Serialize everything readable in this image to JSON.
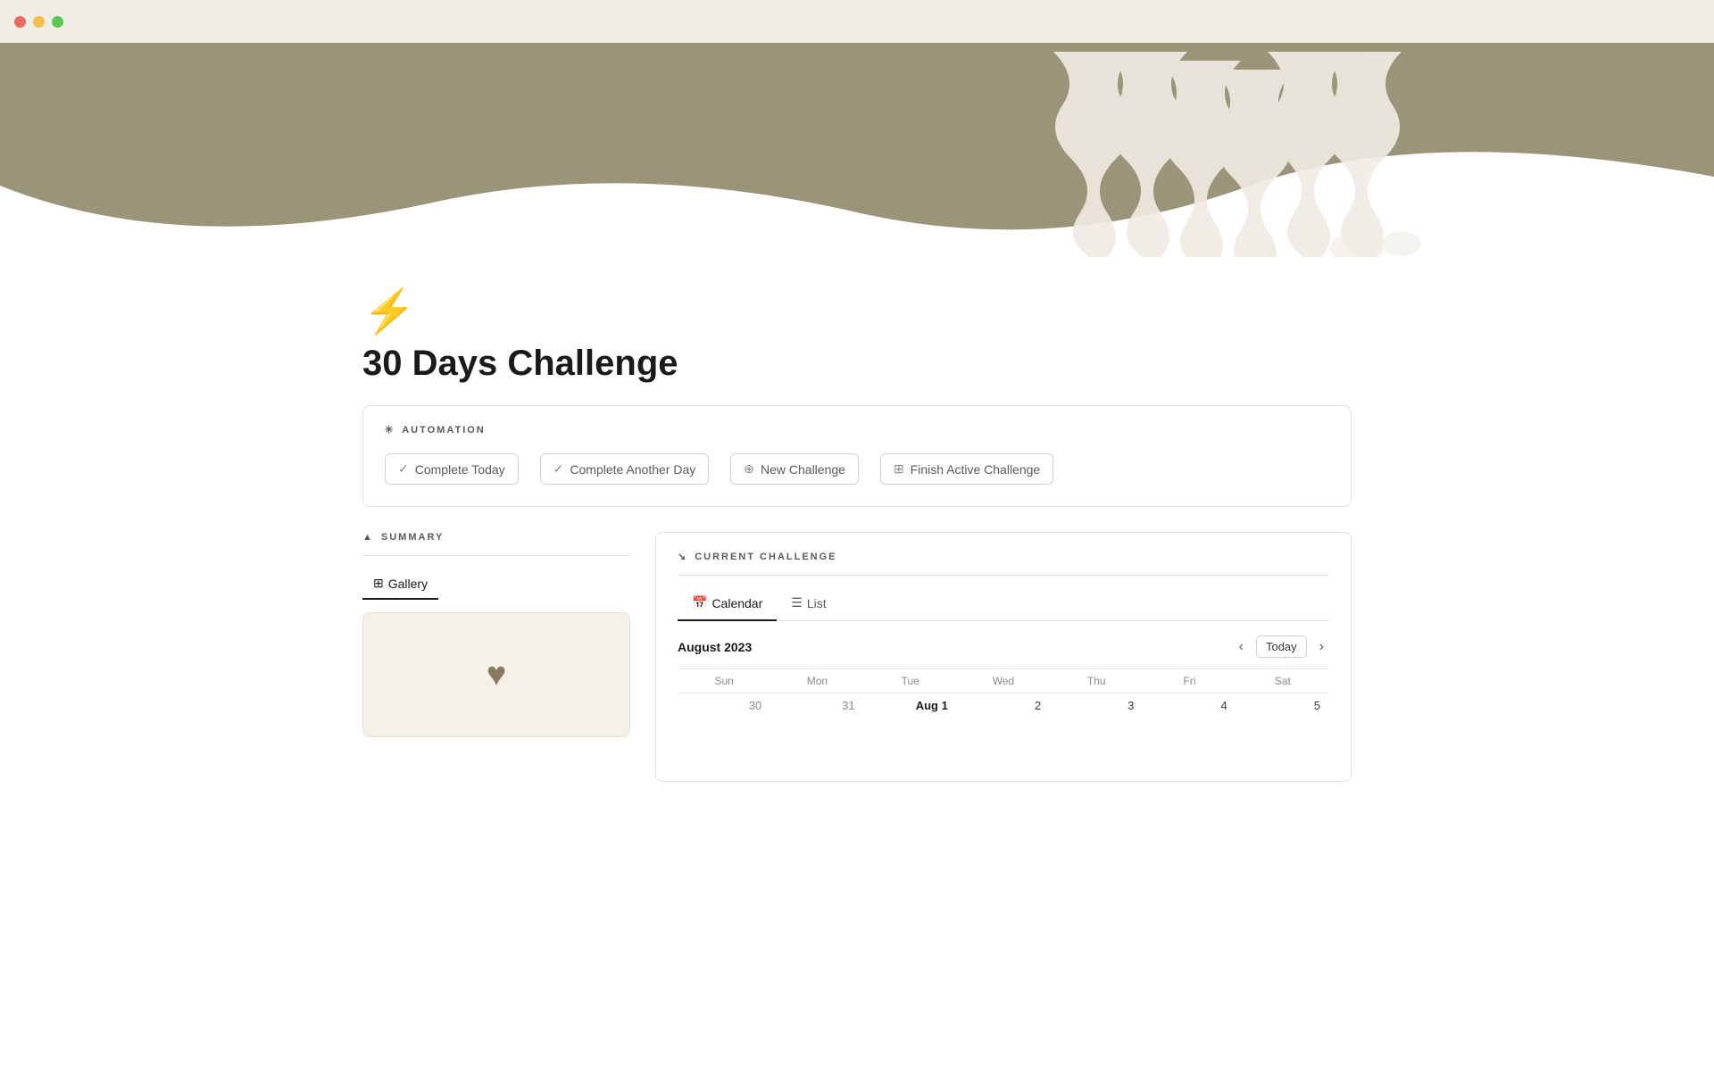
{
  "titlebar": {
    "traffic_red": "#ec6a5e",
    "traffic_yellow": "#f4bf4f",
    "traffic_green": "#61c554"
  },
  "hero": {
    "wave_color": "#9a9478",
    "decoration_color": "#f0ece6"
  },
  "page": {
    "icon": "⚡",
    "title": "30 Days Challenge"
  },
  "automation": {
    "header_icon": "✳",
    "header_label": "AUTOMATION",
    "buttons": [
      {
        "id": "complete-today",
        "icon": "✓",
        "label": "Complete Today"
      },
      {
        "id": "complete-another-day",
        "icon": "✓",
        "label": "Complete Another Day"
      },
      {
        "id": "new-challenge",
        "icon": "+",
        "label": "New Challenge"
      },
      {
        "id": "finish-active-challenge",
        "icon": "⊞",
        "label": "Finish Active Challenge"
      }
    ]
  },
  "summary": {
    "header_icon": "▲",
    "header_label": "SUMMARY",
    "tabs": [
      {
        "id": "gallery",
        "icon": "⊞",
        "label": "Gallery",
        "active": true
      }
    ],
    "gallery_card": {
      "icon": "♥"
    }
  },
  "current_challenge": {
    "header_icon": "↘",
    "header_label": "CURRENT CHALLENGE",
    "tabs": [
      {
        "id": "calendar",
        "icon": "📅",
        "label": "Calendar",
        "active": true
      },
      {
        "id": "list",
        "icon": "☰",
        "label": "List",
        "active": false
      }
    ],
    "calendar": {
      "month_label": "August 2023",
      "today_button": "Today",
      "weekdays": [
        "Sun",
        "Mon",
        "Tue",
        "Wed",
        "Thu",
        "Fri",
        "Sat"
      ],
      "weeks": [
        [
          {
            "day": "30",
            "month": "prev"
          },
          {
            "day": "31",
            "month": "prev"
          },
          {
            "day": "Aug 1",
            "month": "current",
            "is_today": true
          },
          {
            "day": "2",
            "month": "current"
          },
          {
            "day": "3",
            "month": "current"
          },
          {
            "day": "4",
            "month": "current"
          },
          {
            "day": "5",
            "month": "current"
          }
        ]
      ]
    }
  }
}
